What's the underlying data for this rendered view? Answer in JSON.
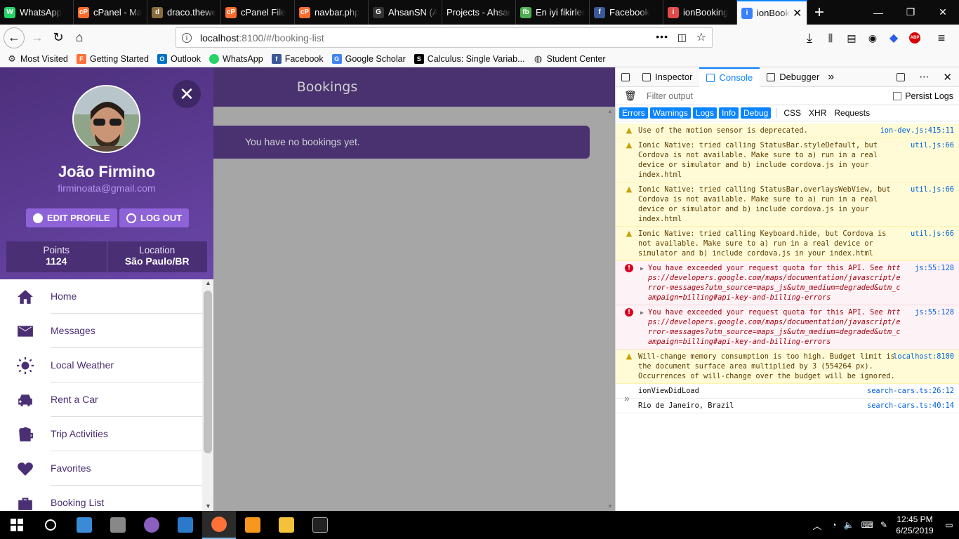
{
  "browser": {
    "tabs": [
      {
        "title": "WhatsApp",
        "icon": "whatsapp-icon",
        "color": "#25d366",
        "glyph": "W"
      },
      {
        "title": "cPanel - Ma",
        "icon": "cpanel-icon",
        "color": "#ff6c2c",
        "glyph": "cP"
      },
      {
        "title": "draco.thewe",
        "icon": "draco-icon",
        "color": "#8a6d3b",
        "glyph": "d"
      },
      {
        "title": "cPanel File",
        "icon": "cpanel-icon",
        "color": "#ff6c2c",
        "glyph": "cP"
      },
      {
        "title": "navbar.php",
        "icon": "cpanel-icon",
        "color": "#ff6c2c",
        "glyph": "cP"
      },
      {
        "title": "AhsanSN (A",
        "icon": "github-icon",
        "color": "#333333",
        "glyph": "G"
      },
      {
        "title": "Projects - Ahsan",
        "icon": "none",
        "color": "#0c0c0d",
        "glyph": ""
      },
      {
        "title": "En iyi fikirler",
        "icon": "fb-icon",
        "color": "#4caf50",
        "glyph": "fb"
      },
      {
        "title": "Facebook",
        "icon": "facebook-icon",
        "color": "#3b5998",
        "glyph": "f"
      },
      {
        "title": "ionBooking",
        "icon": "ion-icon",
        "color": "#e14b4b",
        "glyph": "i"
      },
      {
        "title": "ionBook",
        "icon": "ion-icon",
        "color": "#3880ff",
        "glyph": "i",
        "active": true
      }
    ],
    "url_host": "localhost",
    "url_rest": ":8100/#/booking-list",
    "bookmarks": [
      {
        "label": "Most Visited",
        "icon": "gear-icon",
        "color": "#555555",
        "glyph": "⚙"
      },
      {
        "label": "Getting Started",
        "icon": "firefox-icon",
        "color": "#ff7139",
        "glyph": "F"
      },
      {
        "label": "Outlook",
        "icon": "outlook-icon",
        "color": "#0072c6",
        "glyph": "O"
      },
      {
        "label": "WhatsApp",
        "icon": "whatsapp-icon",
        "color": "#ffffff",
        "glyph": ""
      },
      {
        "label": "Facebook",
        "icon": "facebook-icon",
        "color": "#3b5998",
        "glyph": "f"
      },
      {
        "label": "Google Scholar",
        "icon": "scholar-icon",
        "color": "#4285f4",
        "glyph": "G"
      },
      {
        "label": "Calculus: Single Variab...",
        "icon": "coursera-icon",
        "color": "#000000",
        "glyph": "S"
      },
      {
        "label": "Student Center",
        "icon": "globe-icon",
        "color": "#555555",
        "glyph": "◍"
      }
    ]
  },
  "app": {
    "title": "Bookings",
    "empty_message": "You have no bookings yet.",
    "profile": {
      "name": "João Firmino",
      "email": "firminoata@gmail.com",
      "edit_label": "EDIT PROFILE",
      "logout_label": "LOG OUT",
      "points_label": "Points",
      "points_value": "1124",
      "location_label": "Location",
      "location_value": "São Paulo/BR"
    },
    "menu": [
      {
        "label": "Home",
        "icon": "home-icon"
      },
      {
        "label": "Messages",
        "icon": "mail-icon"
      },
      {
        "label": "Local Weather",
        "icon": "sun-icon"
      },
      {
        "label": "Rent a Car",
        "icon": "car-icon"
      },
      {
        "label": "Trip Activities",
        "icon": "beer-icon"
      },
      {
        "label": "Favorites",
        "icon": "heart-icon"
      },
      {
        "label": "Booking List",
        "icon": "briefcase-icon"
      }
    ],
    "colors": {
      "primary": "#4a2f74",
      "accent": "#8e63d8"
    }
  },
  "devtools": {
    "tabs": [
      "Inspector",
      "Console",
      "Debugger"
    ],
    "filter_placeholder": "Filter output",
    "persist_label": "Persist Logs",
    "levels": [
      "Errors",
      "Warnings",
      "Logs",
      "Info",
      "Debug"
    ],
    "types": [
      "CSS",
      "XHR",
      "Requests"
    ],
    "messages": [
      {
        "level": "warn",
        "text": "Use of the motion sensor is deprecated.",
        "source": "ion-dev.js:415:11"
      },
      {
        "level": "warn",
        "text": "Ionic Native: tried calling StatusBar.styleDefault, but Cordova is not available. Make sure to a) run in a real device or simulator and b) include cordova.js in your index.html",
        "source": "util.js:66"
      },
      {
        "level": "warn",
        "text": "Ionic Native: tried calling StatusBar.overlaysWebView, but Cordova is not available. Make sure to a) run in a real device or simulator and b) include cordova.js in your index.html",
        "source": "util.js:66"
      },
      {
        "level": "warn",
        "text": "Ionic Native: tried calling Keyboard.hide, but Cordova is not available. Make sure to a) run in a real device or simulator and b) include cordova.js in your index.html",
        "source": "util.js:66"
      },
      {
        "level": "err",
        "text": "You have exceeded your request quota for this API. See",
        "link": "https://developers.google.com/maps/documentation/javascript/error-messages?utm_source=maps_js&utm_medium=degraded&utm_campaign=billing#api-key-and-billing-errors",
        "source": "js:55:128"
      },
      {
        "level": "err",
        "text": "You have exceeded your request quota for this API. See",
        "link": "https://developers.google.com/maps/documentation/javascript/error-messages?utm_source=maps_js&utm_medium=degraded&utm_campaign=billing#api-key-and-billing-errors",
        "source": "js:55:128"
      },
      {
        "level": "warn",
        "text": "Will-change memory consumption is too high. Budget limit is the document surface area multiplied by 3 (554264 px). Occurrences of will-change over the budget will be ignored.",
        "source": "localhost:8100"
      },
      {
        "level": "log",
        "text": "ionViewDidLoad",
        "source": "search-cars.ts:26:12"
      },
      {
        "level": "log",
        "text": "Rio de Janeiro, Brazil",
        "source": "search-cars.ts:40:14"
      }
    ]
  },
  "taskbar": {
    "time": "12:45 PM",
    "date": "6/25/2019"
  }
}
